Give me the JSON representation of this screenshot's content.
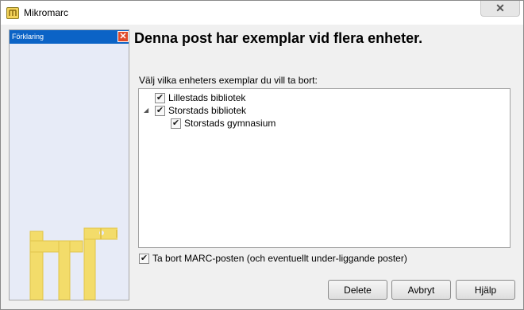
{
  "window": {
    "title": "Mikromarc",
    "close_glyph": "✕"
  },
  "side_panel": {
    "header": "Förklaring",
    "close_glyph": "✕",
    "logo_color": "#f3d35a"
  },
  "dialog": {
    "heading": "Denna post har exemplar vid flera enheter.",
    "prompt": "Välj vilka enheters exemplar du vill ta bort:",
    "tree": [
      {
        "label": "Lillestads bibliotek",
        "checked": true,
        "level": 0,
        "expander": ""
      },
      {
        "label": "Storstads bibliotek",
        "checked": true,
        "level": 0,
        "expander": "◢"
      },
      {
        "label": "Storstads gymnasium",
        "checked": true,
        "level": 1,
        "expander": ""
      }
    ],
    "marc_option": {
      "label": "Ta bort MARC-posten (och eventuellt under-liggande poster)",
      "checked": true
    }
  },
  "buttons": {
    "delete": "Delete",
    "cancel": "Avbryt",
    "help": "Hjälp"
  },
  "colors": {
    "side_header_bg": "#0b63c6",
    "side_panel_bg": "#e7ebf7",
    "side_close_bg": "#e04a2a"
  }
}
